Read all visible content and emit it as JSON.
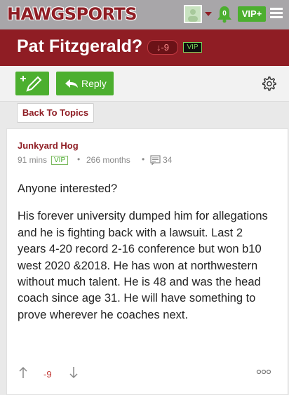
{
  "header": {
    "logo_text": "HAWGSPORTS",
    "notification_count": "0",
    "vip_label": "VIP+"
  },
  "thread": {
    "title": "Pat Fitzgerald?",
    "score": "-9",
    "vip_tag": "VIP"
  },
  "toolbar": {
    "reply_label": "Reply",
    "back_label": "Back To Topics"
  },
  "post": {
    "author": "Junkyard Hog",
    "time": "91 mins",
    "vip_tag": "VIP",
    "member_for": "266 months",
    "post_count": "34",
    "paragraphs": [
      "Anyone interested?",
      "His forever university dumped him for allegations and he is fighting back with a lawsuit. Last 2 years 4-20 record 2-16 conference but won b10 west 2020 &2018. He has won at northwestern without much talent. He is 48 and was the head coach since age 31. He will have something to prove wherever he coaches next."
    ],
    "vote_score": "-9"
  },
  "colors": {
    "brand_maroon": "#8f1d24",
    "accent_green": "#4caf2f",
    "header_gray": "#a8a6a9"
  }
}
